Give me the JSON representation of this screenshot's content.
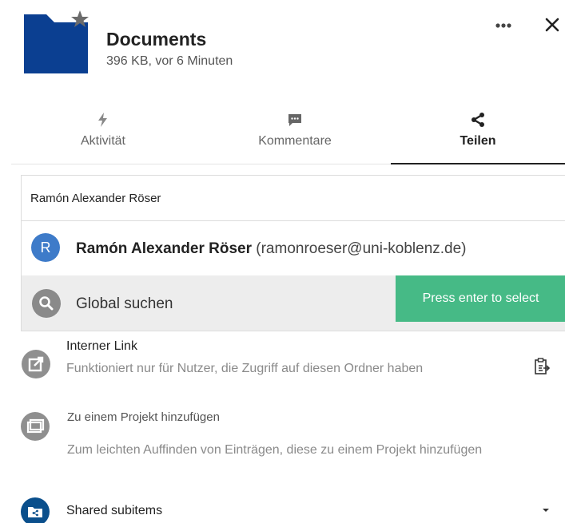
{
  "header": {
    "title": "Documents",
    "subtitle": "396 KB, vor 6 Minuten",
    "folder_icon": "folder-icon",
    "folder_color": "#0b3f91",
    "star_icon": "star-icon",
    "more_icon": "more-icon",
    "close_icon": "close-icon"
  },
  "tabs": [
    {
      "label": "Aktivität",
      "icon": "activity-icon",
      "active": false
    },
    {
      "label": "Kommentare",
      "icon": "comment-icon",
      "active": false
    },
    {
      "label": "Teilen",
      "icon": "share-icon",
      "active": true
    }
  ],
  "search": {
    "value": "Ramón Alexander Röser"
  },
  "suggestion": {
    "avatar_initial": "R",
    "avatar_color": "#3e7bc9",
    "name": "Ramón Alexander Röser",
    "email": "(ramonroeser@uni-koblenz.de)"
  },
  "global_search": {
    "label": "Global suchen",
    "hint": "Press enter to select",
    "hint_color": "#46ba86"
  },
  "internal_link": {
    "title": "Interner Link",
    "description": "Funktioniert nur für Nutzer, die Zugriff auf diesen Ordner haben"
  },
  "project": {
    "title": "Zu einem Projekt hinzufügen",
    "description": "Zum leichten Auffinden von Einträgen, diese zu einem Projekt hinzufügen"
  },
  "shared_subitems": {
    "title": "Shared subitems"
  }
}
